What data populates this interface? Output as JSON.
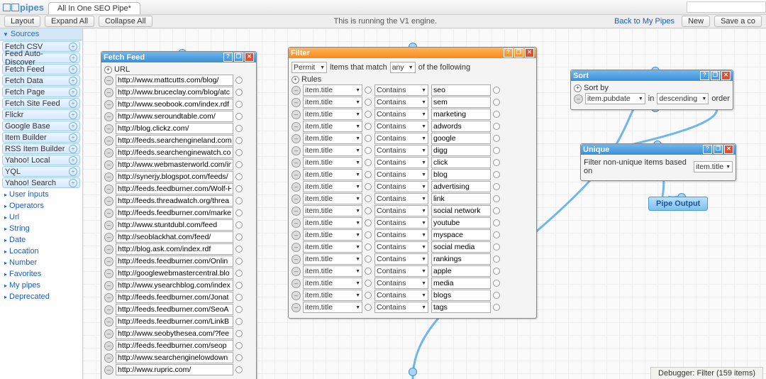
{
  "header": {
    "logo": "pipes",
    "tab": "All In One SEO Pipe*"
  },
  "toolbar": {
    "layout": "Layout",
    "expand": "Expand All",
    "collapse": "Collapse All",
    "center": "This is running the V1 engine.",
    "back": "Back to My Pipes",
    "new_btn": "New",
    "save": "Save a co"
  },
  "sidebar": {
    "sections": [
      "Sources"
    ],
    "modules": [
      "Fetch CSV",
      "Feed Auto-Discover",
      "Fetch Feed",
      "Fetch Data",
      "Fetch Page",
      "Fetch Site Feed",
      "Flickr",
      "Google Base",
      "Item Builder",
      "RSS Item Builder",
      "Yahoo! Local",
      "YQL",
      "Yahoo! Search"
    ],
    "cats": [
      "User inputs",
      "Operators",
      "Url",
      "String",
      "Date",
      "Location",
      "Number",
      "Favorites",
      "My pipes",
      "Deprecated"
    ]
  },
  "fetch": {
    "title": "Fetch Feed",
    "section": "URL",
    "urls": [
      "http://www.mattcutts.com/blog/",
      "http://www.bruceclay.com/blog/atc",
      "http://www.seobook.com/index.rdf",
      "http://www.seroundtable.com/",
      "http://blog.clickz.com/",
      "http://feeds.searchengineland.com",
      "http://feeds.searchenginewatch.co",
      "http://www.webmasterworld.com/in",
      "http://synerjy.blogspot.com/feeds/",
      "http://feeds.feedburner.com/Wolf-H",
      "http://feeds.threadwatch.org/threa",
      "http://feeds.feedburner.com/marke",
      "http://www.stuntdubl.com/feed",
      "http://seoblackhat.com/feed/",
      "http://blog.ask.com/index.rdf",
      "http://feeds.feedburner.com/Onlin",
      "http://googlewebmastercentral.blo",
      "http://www.ysearchblog.com/index",
      "http://feeds.feedburner.com/Jonat",
      "http://feeds.feedburner.com/SeoA",
      "http://feeds.feedburner.com/LinkB",
      "http://www.seobythesea.com/?fee",
      "http://feeds.feedburner.com/seop",
      "http://www.searchenginelowdown",
      "http://www.rupric.com/"
    ]
  },
  "filter": {
    "title": "Filter",
    "cond1": "Permit",
    "cond2": "items that match",
    "cond3": "any",
    "cond4": "of the following",
    "rules_label": "Rules",
    "field": "item.title",
    "op": "Contains",
    "values": [
      "seo",
      "sem",
      "marketing",
      "adwords",
      "google",
      "digg",
      "click",
      "blog",
      "advertising",
      "link",
      "social network",
      "youtube",
      "myspace",
      "social media",
      "rankings",
      "apple",
      "media",
      "blogs",
      "tags"
    ]
  },
  "sort": {
    "title": "Sort",
    "section": "Sort by",
    "field": "item.pubdate",
    "in": "in",
    "dir": "descending",
    "order": "order"
  },
  "unique": {
    "title": "Unique",
    "label": "Filter non-unique items based on",
    "field": "item.title"
  },
  "output": "Pipe Output",
  "debugger": "Debugger: Filter (159 items)"
}
